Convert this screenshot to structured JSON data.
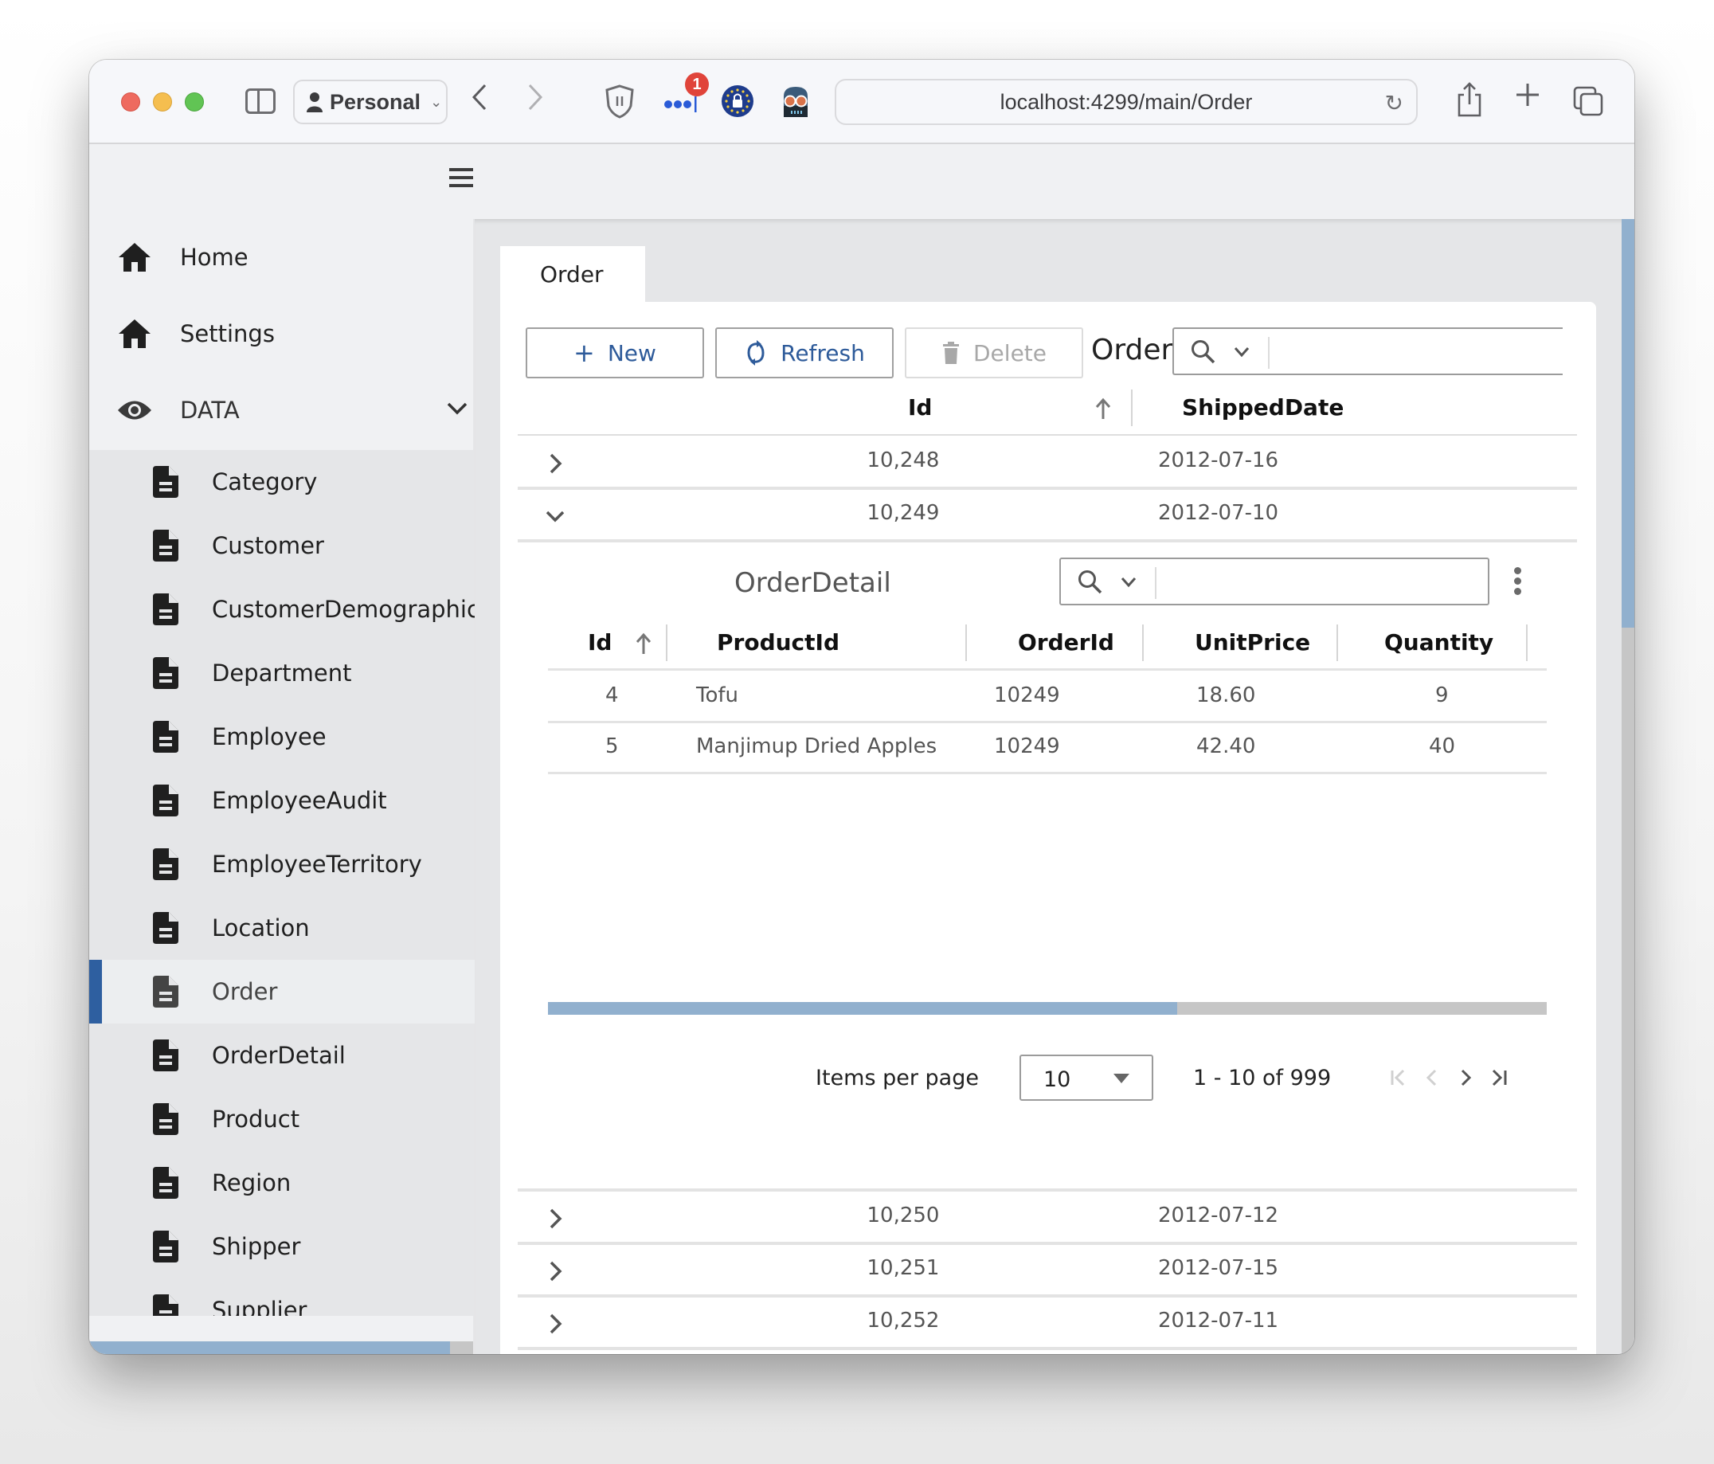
{
  "browser": {
    "profile_label": "Personal",
    "url": "localhost:4299/main/Order",
    "extension_badge_count": "1"
  },
  "sidebar": {
    "top_items": [
      {
        "label": "Home",
        "icon": "home-icon"
      },
      {
        "label": "Settings",
        "icon": "home-icon"
      },
      {
        "label": "DATA",
        "icon": "eye-icon",
        "expanded": true
      }
    ],
    "data_items": [
      {
        "label": "Category",
        "icon": "document-icon"
      },
      {
        "label": "Customer",
        "icon": "document-icon"
      },
      {
        "label": "CustomerDemographic",
        "icon": "document-icon"
      },
      {
        "label": "Department",
        "icon": "document-icon"
      },
      {
        "label": "Employee",
        "icon": "document-icon"
      },
      {
        "label": "EmployeeAudit",
        "icon": "document-icon"
      },
      {
        "label": "EmployeeTerritory",
        "icon": "document-icon"
      },
      {
        "label": "Location",
        "icon": "document-icon"
      },
      {
        "label": "Order",
        "icon": "document-icon",
        "active": true
      },
      {
        "label": "OrderDetail",
        "icon": "document-icon"
      },
      {
        "label": "Product",
        "icon": "document-icon"
      },
      {
        "label": "Region",
        "icon": "document-icon"
      },
      {
        "label": "Shipper",
        "icon": "document-icon"
      },
      {
        "label": "Supplier",
        "icon": "document-icon"
      }
    ],
    "hscroll_fraction": 0.94
  },
  "main": {
    "tab_label": "Order",
    "toolbar": {
      "new_label": "New",
      "refresh_label": "Refresh",
      "delete_label": "Delete",
      "grid_title": "Order",
      "search_value": "",
      "search_placeholder": ""
    },
    "columns": {
      "id": "Id",
      "shipped_date": "ShippedDate",
      "sort": "ascending"
    },
    "rows_before": [
      {
        "id": "10,248",
        "shipped_date": "2012-07-16",
        "expanded": false
      },
      {
        "id": "10,249",
        "shipped_date": "2012-07-10",
        "expanded": true
      }
    ],
    "detail": {
      "title": "OrderDetail",
      "search_value": "",
      "columns": [
        "Id",
        "ProductId",
        "OrderId",
        "UnitPrice",
        "Quantity"
      ],
      "rows": [
        {
          "id": "4",
          "product": "Tofu",
          "order_id": "10249",
          "unit_price": "18.60",
          "quantity": "9"
        },
        {
          "id": "5",
          "product": "Manjimup Dried Apples",
          "order_id": "10249",
          "unit_price": "42.40",
          "quantity": "40"
        }
      ],
      "hscroll_fraction": 0.63,
      "pager": {
        "items_per_page_label": "Items per page",
        "items_per_page": "10",
        "range_label": "1 - 10 of 999"
      }
    },
    "rows_after": [
      {
        "id": "10,250",
        "shipped_date": "2012-07-12"
      },
      {
        "id": "10,251",
        "shipped_date": "2012-07-15"
      },
      {
        "id": "10,252",
        "shipped_date": "2012-07-11"
      }
    ],
    "vscroll_fraction": 0.36
  },
  "colors": {
    "accent": "#2e5fa0",
    "scroll_thumb": "#91b0ce",
    "scroll_track": "#c6c6c6",
    "button_text": "#2e5b9a"
  }
}
